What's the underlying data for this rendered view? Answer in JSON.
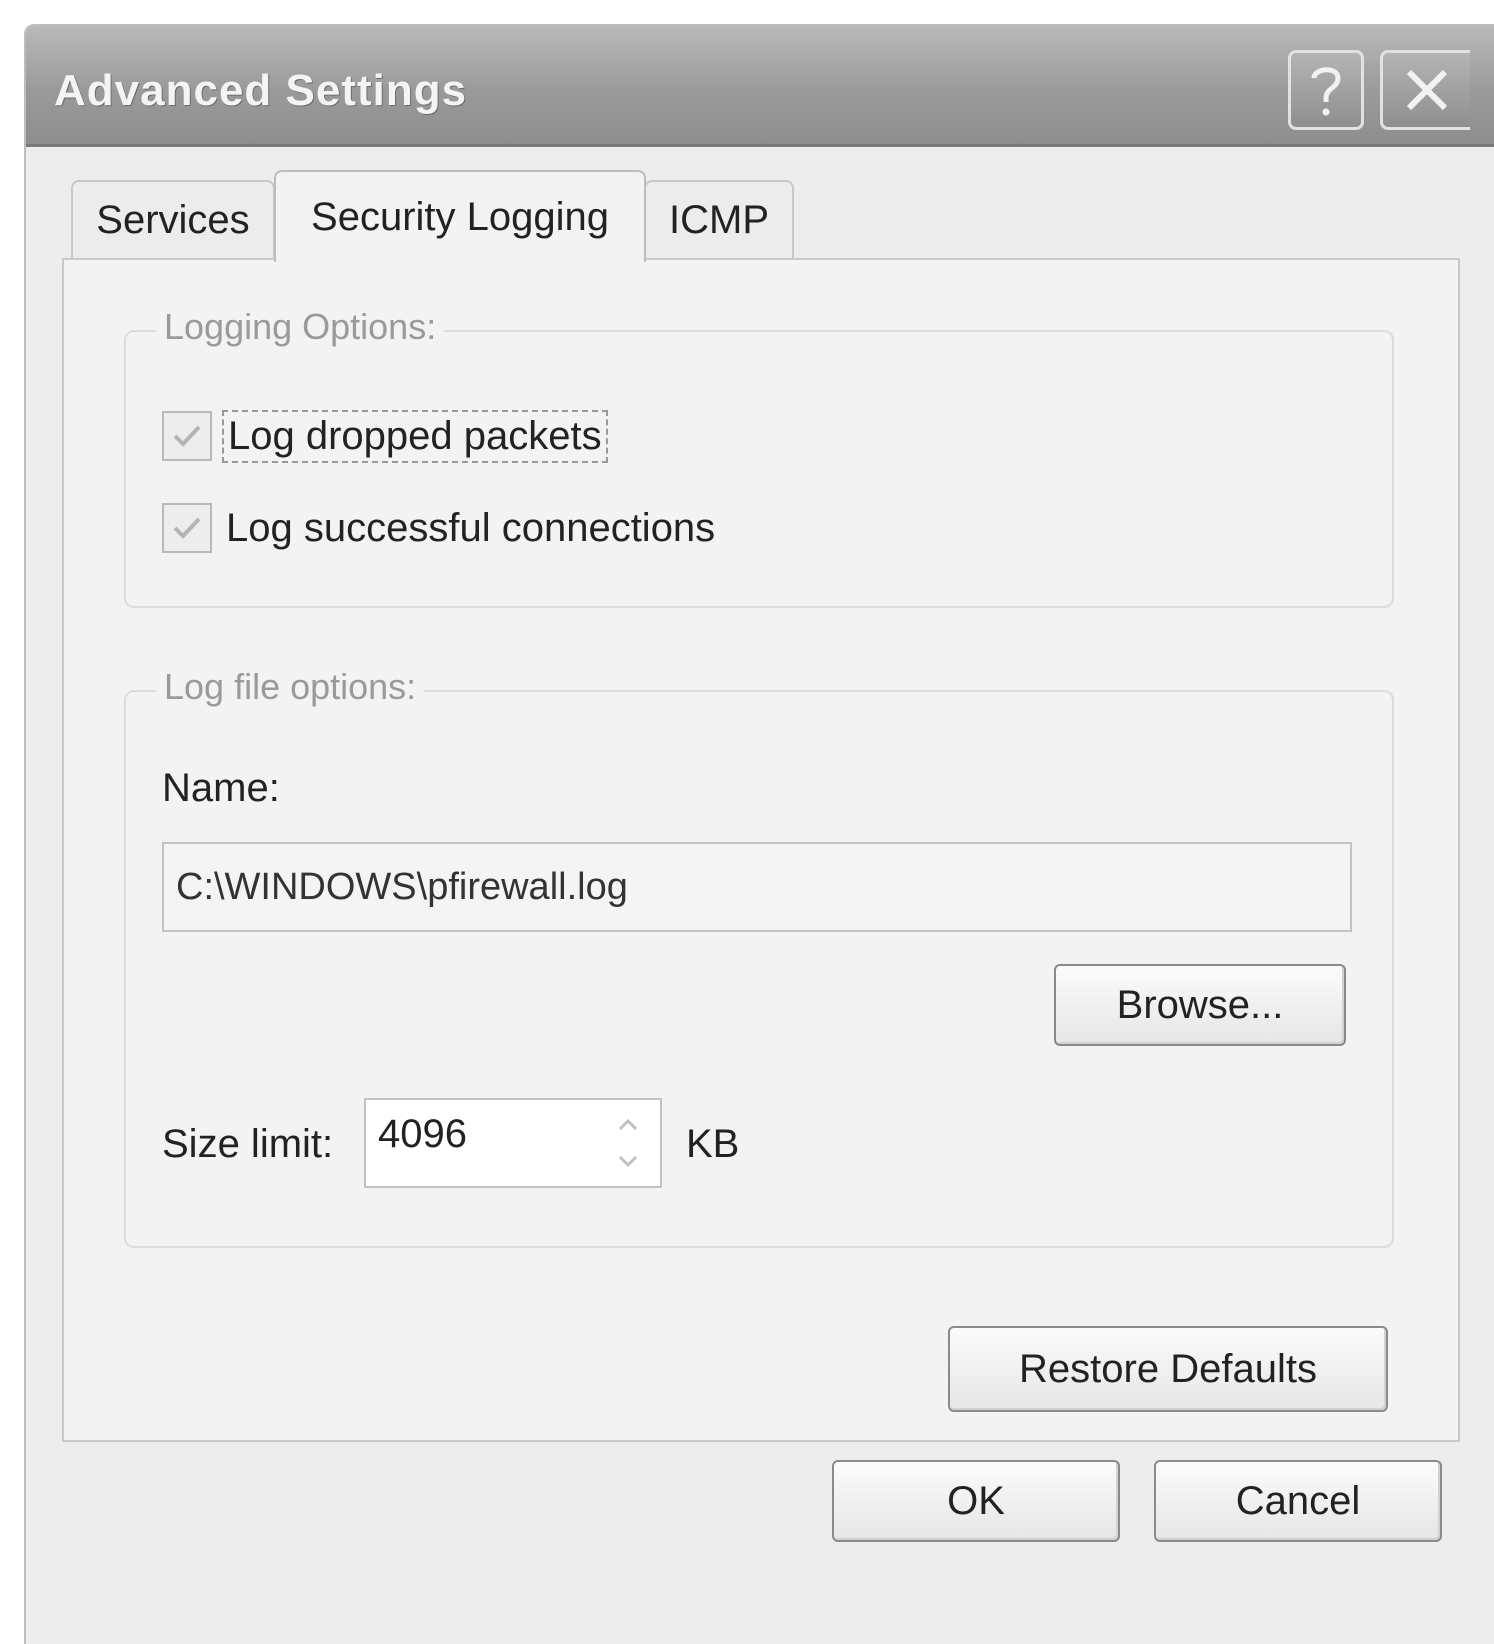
{
  "window": {
    "title": "Advanced Settings",
    "help_icon": "help-question-icon",
    "close_icon": "close-x-icon"
  },
  "tabs": [
    {
      "label": "Services",
      "selected": false
    },
    {
      "label": "Security Logging",
      "selected": true
    },
    {
      "label": "ICMP",
      "selected": false
    }
  ],
  "logging_options": {
    "legend": "Logging Options:",
    "log_dropped": {
      "label": "Log dropped packets",
      "checked": true
    },
    "log_successful": {
      "label": "Log successful connections",
      "checked": true
    }
  },
  "log_file_options": {
    "legend": "Log file options:",
    "name_label": "Name:",
    "name_value": "C:\\WINDOWS\\pfirewall.log",
    "browse_label": "Browse...",
    "size_label": "Size limit:",
    "size_value": "4096",
    "size_unit": "KB"
  },
  "buttons": {
    "restore_defaults": "Restore Defaults",
    "ok": "OK",
    "cancel": "Cancel"
  },
  "colors": {
    "dialog_bg": "#ededed",
    "titlebar": "#9a9a9a",
    "group_legend": "#9a9a9a"
  }
}
